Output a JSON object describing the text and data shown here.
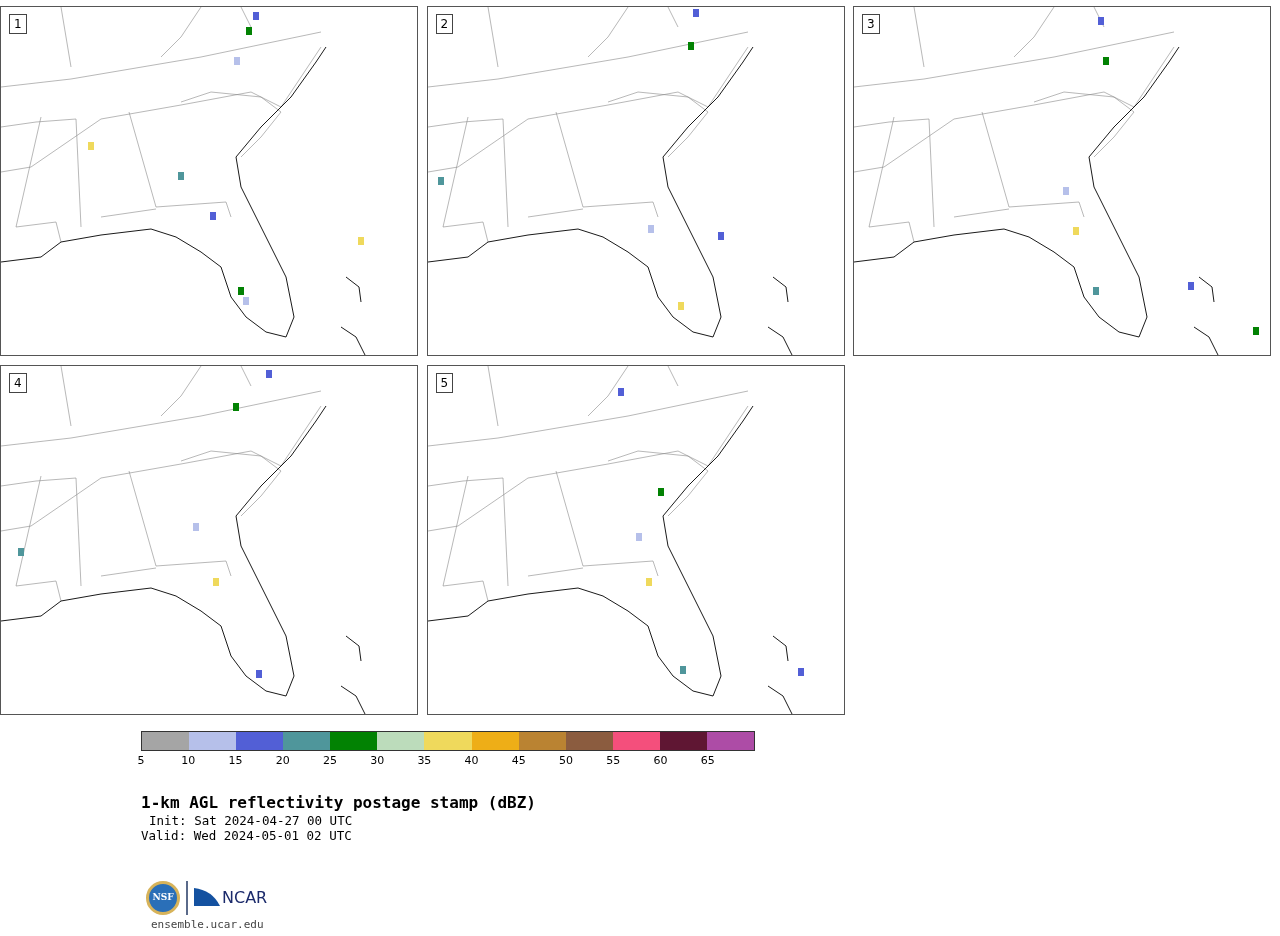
{
  "panels": [
    {
      "label": "1"
    },
    {
      "label": "2"
    },
    {
      "label": "3"
    },
    {
      "label": "4"
    },
    {
      "label": "5"
    }
  ],
  "colorbar": {
    "segments": [
      {
        "color": "#a5a5a5"
      },
      {
        "color": "#b6c0ea"
      },
      {
        "color": "#525fd6"
      },
      {
        "color": "#4f969b"
      },
      {
        "color": "#028203"
      },
      {
        "color": "#bcdcbb"
      },
      {
        "color": "#efd95c"
      },
      {
        "color": "#eeae17"
      },
      {
        "color": "#ba8332"
      },
      {
        "color": "#8b5c3f"
      },
      {
        "color": "#f44f7c"
      },
      {
        "color": "#5f1633"
      },
      {
        "color": "#ad4ca6"
      }
    ],
    "ticks": [
      "5",
      "10",
      "15",
      "20",
      "25",
      "30",
      "35",
      "40",
      "45",
      "50",
      "55",
      "60",
      "65"
    ]
  },
  "title": "1-km AGL reflectivity postage stamp (dBZ)",
  "init": "Init: Sat 2024-04-27 00 UTC",
  "valid": "Valid: Wed 2024-05-01 02 UTC",
  "logo": {
    "nsf": "NSF",
    "ncar": "NCAR"
  },
  "website": "ensemble.ucar.edu"
}
